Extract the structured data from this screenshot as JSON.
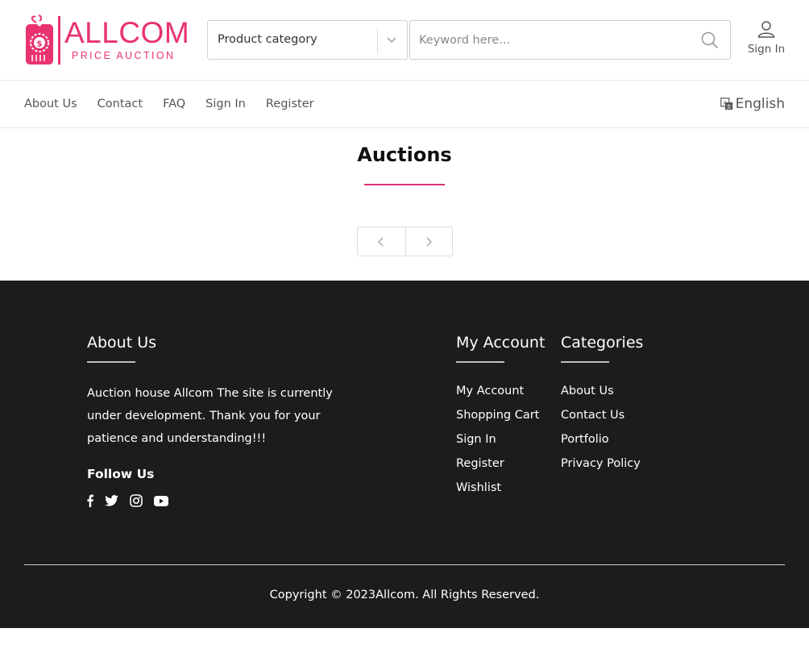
{
  "brand": {
    "name": "ALLCOM",
    "tagline": "PRICE AUCTION",
    "accent": "#e8336e"
  },
  "search": {
    "category_label": "Product category",
    "keyword_placeholder": "Keyword here..."
  },
  "header": {
    "signin_label": "Sign In"
  },
  "nav": {
    "items": [
      {
        "label": "About Us"
      },
      {
        "label": "Contact"
      },
      {
        "label": "FAQ"
      },
      {
        "label": "Sign In"
      },
      {
        "label": "Register"
      }
    ],
    "language": "English"
  },
  "main": {
    "title": "Auctions"
  },
  "footer": {
    "about_heading": "About Us",
    "about_text": "Auction house Allcom The site is currently under development. Thank you for your patience and understanding!!!",
    "follow_heading": "Follow Us",
    "socials": [
      "facebook-icon",
      "twitter-icon",
      "instagram-icon",
      "youtube-icon"
    ],
    "account_heading": "My Account",
    "account_links": [
      "My Account",
      "Shopping Cart",
      "Sign In",
      "Register",
      "Wishlist"
    ],
    "categories_heading": "Categories",
    "category_links": [
      "About Us",
      "Contact Us",
      "Portfolio",
      "Privacy Policy"
    ],
    "copyright": "Copyright © 2023Allcom. All Rights Reserved."
  }
}
